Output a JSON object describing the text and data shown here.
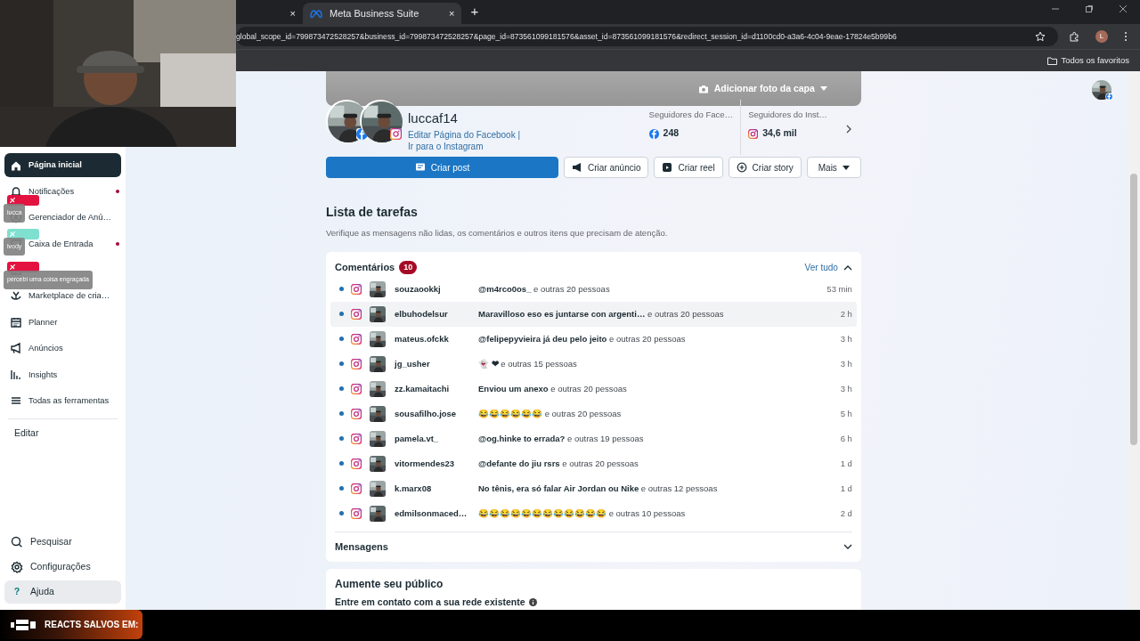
{
  "browser": {
    "tabs": [
      {
        "close": "×",
        "selected": false
      },
      {
        "title": "Meta Business Suite",
        "close": "×",
        "selected": true
      }
    ],
    "new_tab": "+",
    "url": "global_scope_id=799873472528257&business_id=799873472528257&page_id=873561099181576&asset_id=873561099181576&redirect_session_id=d1100cd0-a3a6-4c04-9eae-17824e5b99b6",
    "profile_initial": "L",
    "bookmarks": [
      {
        "label": "Todos os favoritos"
      }
    ]
  },
  "sidebar": {
    "items": [
      {
        "label": "Página inicial",
        "selected": true,
        "unread": false
      },
      {
        "label": "Notificações",
        "selected": false,
        "unread": true
      },
      {
        "label": "Gerenciador de Anú…",
        "selected": false,
        "unread": false
      },
      {
        "label": "Caixa de Entrada",
        "selected": false,
        "unread": true
      },
      {
        "selected": false,
        "unread": false
      },
      {
        "label": "Marketplace de cria…",
        "selected": false,
        "unread": false
      },
      {
        "label": "Planner",
        "selected": false,
        "unread": false
      },
      {
        "label": "Anúncios",
        "selected": false,
        "unread": false
      },
      {
        "label": "Insights",
        "selected": false,
        "unread": false
      },
      {
        "label": "Todas as ferramentas",
        "selected": false,
        "unread": false
      }
    ],
    "edit": "Editar",
    "bottom_items": [
      {
        "label": "Pesquisar",
        "selected": false
      },
      {
        "label": "Configurações",
        "selected": false
      },
      {
        "label": "Ajuda",
        "icon": "?",
        "selected": true
      }
    ]
  },
  "chat_overlay": [
    {
      "color": "#e3123f",
      "text": "lucca"
    },
    {
      "color": "#7fe0cf",
      "text": "lvody"
    },
    {
      "color": "#e3123f",
      "text": "percebi uma coisa engraçada"
    }
  ],
  "cover": {
    "button": "Adicionar foto da capa"
  },
  "profile": {
    "name": "luccaf14",
    "links": [
      "Editar Página do Facebook",
      "Ir para o Instagram"
    ],
    "separator": "|",
    "followers": [
      {
        "kind": "facebook",
        "label": "Seguidores do Face…",
        "value": "248"
      },
      {
        "kind": "instagram",
        "label": "Seguidores do Inst…",
        "value": "34,6 mil"
      }
    ]
  },
  "actions": [
    {
      "kind": "primary",
      "label": "Criar post"
    },
    {
      "kind": "ad",
      "label": "Criar anúncio"
    },
    {
      "kind": "reel",
      "label": "Criar reel"
    },
    {
      "kind": "story",
      "label": "Criar story"
    },
    {
      "kind": "dropdown",
      "label": "Mais"
    }
  ],
  "tasks": {
    "title": "Lista de tarefas",
    "subtitle": "Verifique as mensagens não lidas, os comentários e outros itens que precisam de atenção."
  },
  "comments": {
    "title": "Comentários",
    "count": "10",
    "view_all": "Ver tudo",
    "expanded": true,
    "rows": [
      {
        "user": "souzaookkj",
        "comment": "@m4rco0os_",
        "others": "e outras 20 pessoas",
        "time": "53 min",
        "unread": true,
        "highlighted": false
      },
      {
        "user": "elbuhodelsur",
        "comment": "Maravilloso eso es juntarse con argenti…",
        "others": "e outras 20 pessoas",
        "time": "2 h",
        "unread": true,
        "highlighted": true
      },
      {
        "user": "mateus.ofckk",
        "comment": "@felipepyvieira já deu pelo jeito",
        "others": "e outras 20 pessoas",
        "time": "3 h",
        "unread": true,
        "highlighted": false
      },
      {
        "user": "jg_usher",
        "comment": "👻 ❤",
        "others": "e outras 15 pessoas",
        "time": "3 h",
        "unread": true,
        "highlighted": false
      },
      {
        "user": "zz.kamaitachi",
        "comment": "Enviou um anexo",
        "others": "e outras 20 pessoas",
        "time": "3 h",
        "unread": true,
        "highlighted": false
      },
      {
        "user": "sousafilho.jose",
        "comment": "😂😂😂😂😂😂",
        "others": "e outras 20 pessoas",
        "time": "5 h",
        "unread": true,
        "highlighted": false
      },
      {
        "user": "pamela.vt_",
        "comment": "@og.hinke to errada?",
        "others": "e outras 19 pessoas",
        "time": "6 h",
        "unread": true,
        "highlighted": false
      },
      {
        "user": "vitormendes23",
        "comment": "@defante do jiu rsrs",
        "others": "e outras 20 pessoas",
        "time": "1 d",
        "unread": true,
        "highlighted": false
      },
      {
        "user": "k.marx08",
        "comment": "No tênis, era só falar Air Jordan ou Nike",
        "others": "e outras 12 pessoas",
        "time": "1 d",
        "unread": true,
        "highlighted": false
      },
      {
        "user": "edmilsonmaced…",
        "comment": "😂😂😂😂😂😂😂😂😂😂😂😂",
        "others": "e outras 10 pessoas",
        "time": "2 d",
        "unread": true,
        "highlighted": false
      }
    ]
  },
  "messages": {
    "title": "Mensagens",
    "expanded": false
  },
  "audience": {
    "title": "Aumente seu público",
    "subtitle": "Entre em contato com a sua rede existente"
  },
  "banner": {
    "text": "REACTS SALVOS EM:"
  }
}
